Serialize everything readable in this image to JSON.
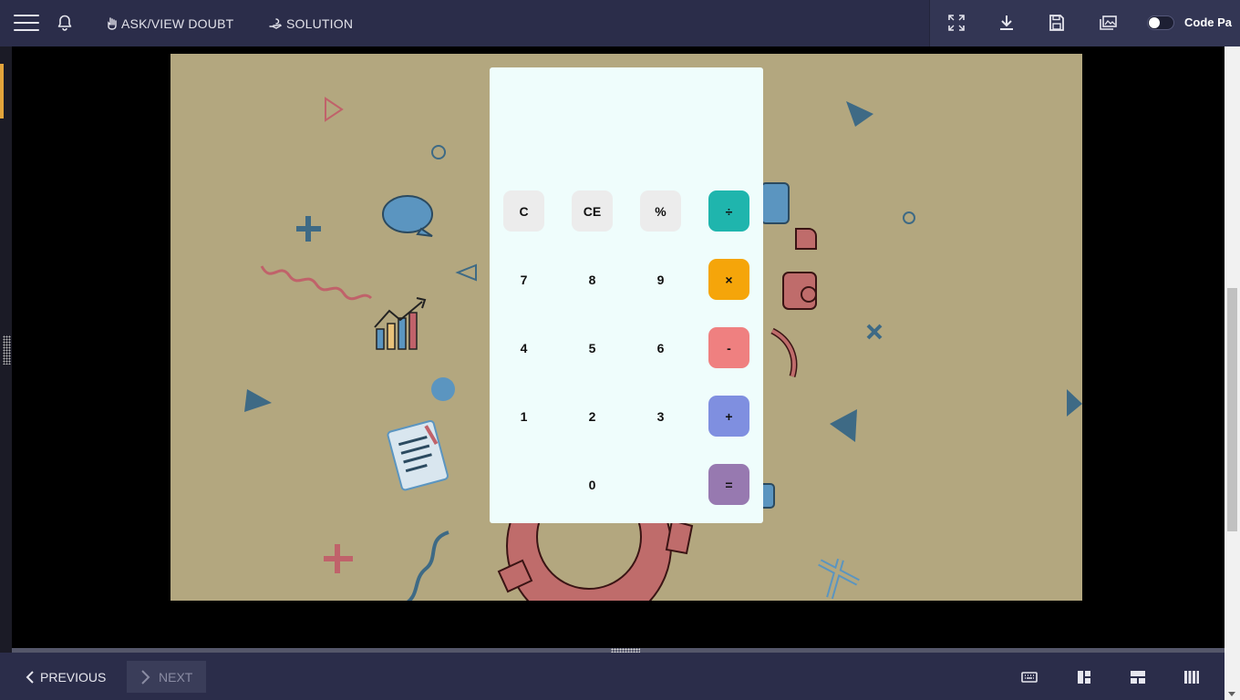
{
  "topbar": {
    "doubt_label": "ASK/VIEW DOUBT",
    "solution_label": "SOLUTION",
    "codepad_label": "Code Pa"
  },
  "bottombar": {
    "previous_label": "PREVIOUS",
    "next_label": "NEXT"
  },
  "calculator": {
    "display_value": "",
    "keys": {
      "clear": "C",
      "clear_entry": "CE",
      "percent": "%",
      "divide": "÷",
      "seven": "7",
      "eight": "8",
      "nine": "9",
      "multiply": "×",
      "four": "4",
      "five": "5",
      "six": "6",
      "minus": "-",
      "one": "1",
      "two": "2",
      "three": "3",
      "plus": "+",
      "zero": "0",
      "equals": "="
    },
    "colors": {
      "divide": "#1fb5ad",
      "multiply": "#f5a50a",
      "minus": "#ef8080",
      "plus": "#7f8fe0",
      "equals": "#9779b0"
    }
  },
  "colors": {
    "header_bg": "#2b2d4a",
    "canvas_bg": "#b3a77f",
    "accent": "#e2a43b"
  }
}
